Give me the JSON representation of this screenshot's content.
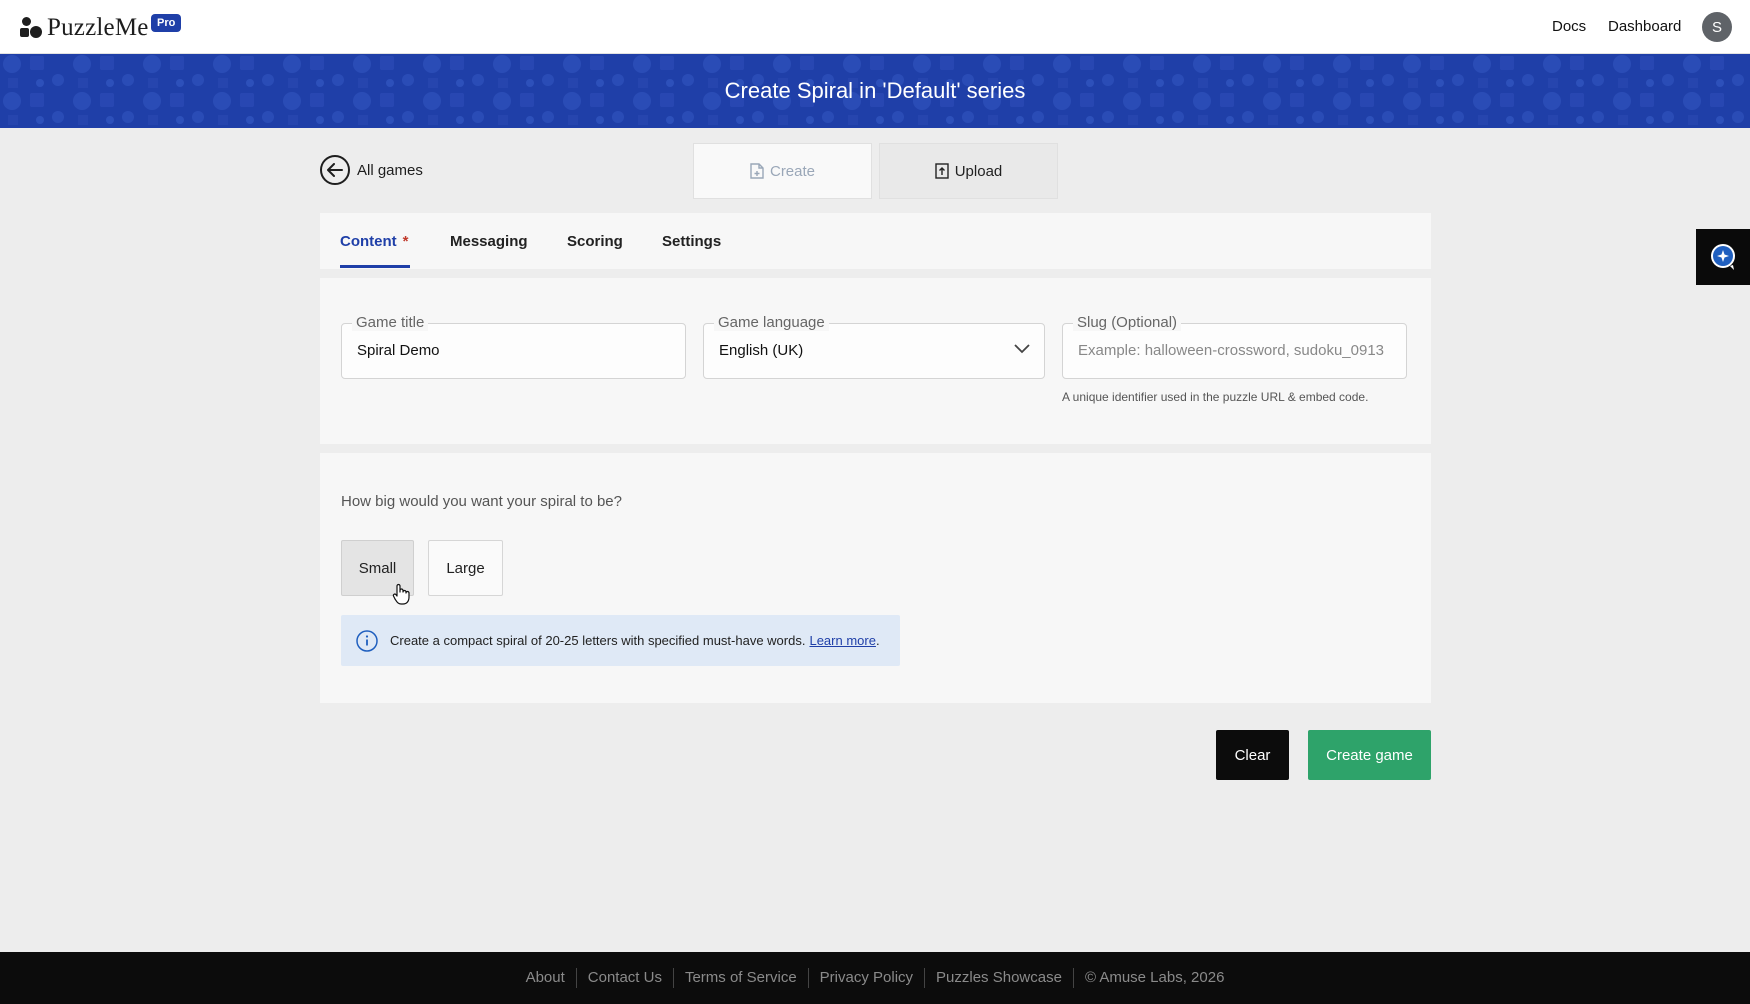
{
  "header": {
    "logo_text": "PuzzleMe",
    "pro_badge": "Pro",
    "nav": {
      "docs": "Docs",
      "dashboard": "Dashboard"
    },
    "avatar_initial": "S"
  },
  "banner": {
    "title": "Create Spiral in 'Default' series"
  },
  "back_link": {
    "label": "All games"
  },
  "mode_tabs": {
    "create": "Create",
    "upload": "Upload",
    "active": "Create"
  },
  "tabs": {
    "content": "Content",
    "content_required_mark": "*",
    "messaging": "Messaging",
    "scoring": "Scoring",
    "settings": "Settings",
    "active": "Content"
  },
  "form": {
    "game_title": {
      "label": "Game title",
      "value": "Spiral Demo"
    },
    "game_language": {
      "label": "Game language",
      "value": "English (UK)"
    },
    "slug": {
      "label": "Slug (Optional)",
      "placeholder": "Example: halloween-crossword, sudoku_0913",
      "helper": "A unique identifier used in the puzzle URL & embed code."
    }
  },
  "spiral_size": {
    "question": "How big would you want your spiral to be?",
    "options": {
      "small": "Small",
      "large": "Large"
    },
    "selected": "Small",
    "info_text": "Create a compact spiral of 20-25 letters with specified must-have words.",
    "info_link": "Learn more",
    "info_link_suffix": "."
  },
  "actions": {
    "clear": "Clear",
    "create_game": "Create game"
  },
  "footer": {
    "links": [
      "About",
      "Contact Us",
      "Terms of Service",
      "Privacy Policy",
      "Puzzles Showcase"
    ],
    "copyright": "© Amuse Labs, 2026"
  },
  "colors": {
    "brand_blue": "#1f3fa8",
    "create_green": "#2ea36a",
    "info_bg": "#dfe9f6",
    "footer_bg": "#0c0c0c"
  },
  "icons": [
    "back-arrow-icon",
    "create-doc-icon",
    "upload-doc-icon",
    "chevron-down-icon",
    "info-icon",
    "hand-pointer-icon",
    "chat-assistant-icon"
  ]
}
